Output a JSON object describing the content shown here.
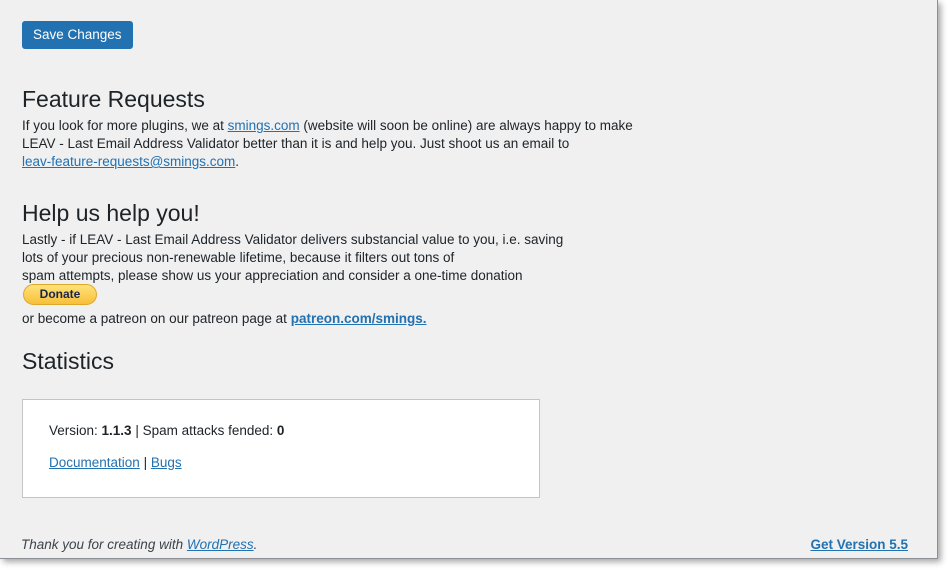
{
  "save_button": "Save Changes",
  "feature_requests": {
    "title": "Feature Requests",
    "line1_pre": "If you look for more plugins, we at ",
    "line1_link": "smings.com",
    "line1_post": " (website will soon be online) are always happy to make",
    "line2": "LEAV - Last Email Address Validator better than it is and help you. Just shoot us an email to",
    "email_link": "leav-feature-requests@smings.com",
    "email_post": "."
  },
  "help": {
    "title": "Help us help you!",
    "line1": "Lastly - if LEAV - Last Email Address Validator delivers substancial value to you, i.e. saving",
    "line2": "lots of your precious non-renewable lifetime, because it filters out tons of",
    "line3": "spam attempts, please show us your appreciation and consider a one-time donation",
    "donate_label": "Donate",
    "patreon_pre": "or become a patreon on our patreon page at ",
    "patreon_link": "patreon.com/smings."
  },
  "statistics": {
    "title": "Statistics",
    "version_label": "Version: ",
    "version_value": "1.1.3",
    "separator": " | ",
    "spam_label": "Spam attacks fended: ",
    "spam_value": "0",
    "documentation_link": "Documentation",
    "bugs_link": "Bugs"
  },
  "footer": {
    "thanks_pre": "Thank you for creating with ",
    "thanks_link": "WordPress",
    "thanks_post": ".",
    "version_link": "Get Version 5.5"
  },
  "colors": {
    "accent": "#2271b1",
    "background": "#f0f0f1",
    "donate_yellow": "#f7c03a"
  }
}
